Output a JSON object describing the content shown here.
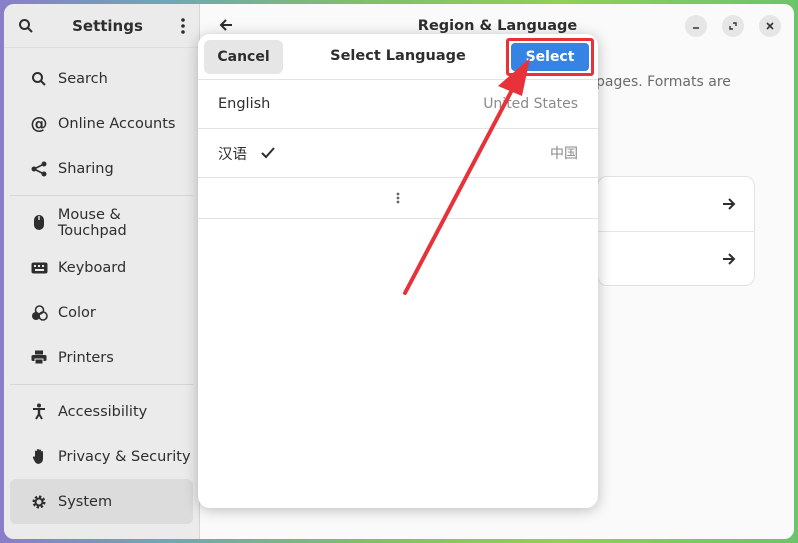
{
  "sidebar": {
    "title": "Settings",
    "items": [
      {
        "label": "Search",
        "icon": "search-icon"
      },
      {
        "label": "Online Accounts",
        "icon": "at-icon"
      },
      {
        "label": "Sharing",
        "icon": "share-icon"
      },
      {
        "label": "Mouse & Touchpad",
        "icon": "mouse-icon"
      },
      {
        "label": "Keyboard",
        "icon": "keyboard-icon"
      },
      {
        "label": "Color",
        "icon": "color-icon"
      },
      {
        "label": "Printers",
        "icon": "printer-icon"
      },
      {
        "label": "Accessibility",
        "icon": "accessibility-icon"
      },
      {
        "label": "Privacy & Security",
        "icon": "hand-icon"
      },
      {
        "label": "System",
        "icon": "gear-icon"
      }
    ]
  },
  "main": {
    "title": "Region & Language",
    "description_visible": "pages. Formats are"
  },
  "dialog": {
    "title": "Select Language",
    "cancel_label": "Cancel",
    "select_label": "Select",
    "languages": [
      {
        "name": "English",
        "region": "United States",
        "selected": false
      },
      {
        "name": "汉语",
        "region": "中国",
        "selected": true
      }
    ]
  },
  "colors": {
    "accent": "#3584e4",
    "highlight": "#e8323a"
  }
}
